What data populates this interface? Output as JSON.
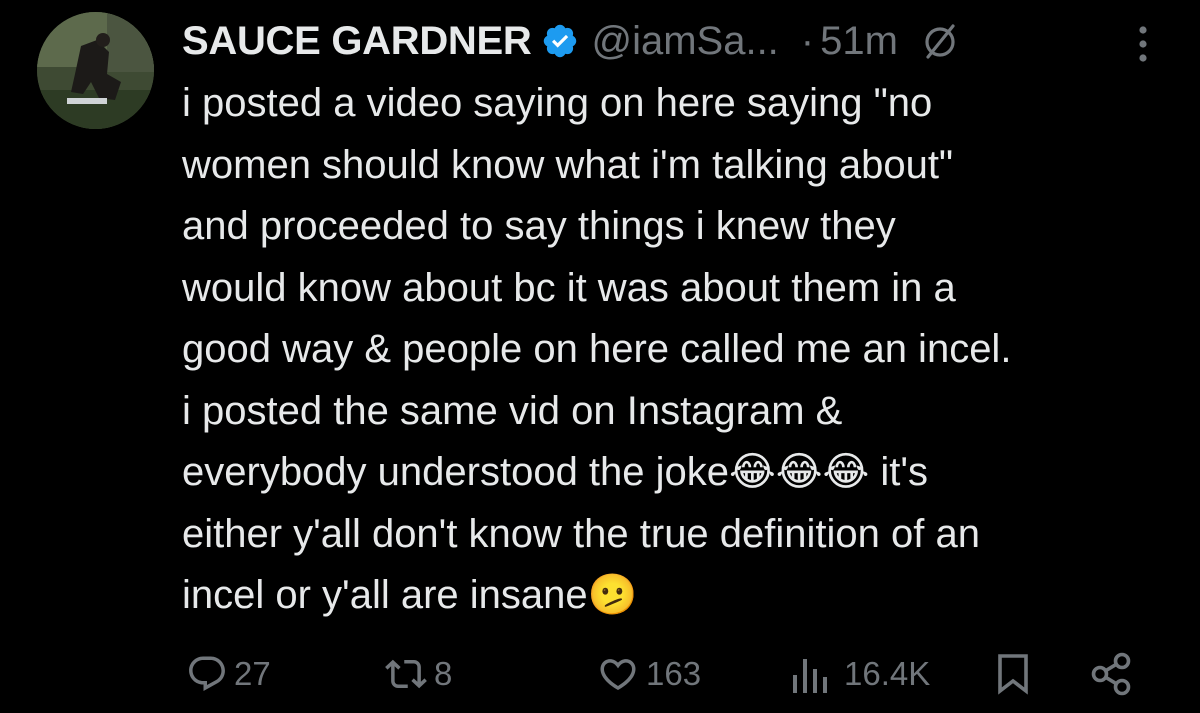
{
  "tweet": {
    "author_name": "SAUCE GARDNER",
    "handle": "@iamSa...",
    "separator": "·",
    "time": "51m",
    "text": "i posted a video saying on here saying \"no\nwomen should know what i'm talking about\"\nand proceeded to say things i knew they\nwould know about bc it was about them in a\ngood way & people on here called me an incel.\ni posted the same vid on Instagram &\neverybody understood the joke😂😂😂 it's\neither y'all don't know the true definition of an\nincel or y'all are insane🫤",
    "colors": {
      "background": "#000000",
      "text": "#e7e9ea",
      "secondary": "#71767b",
      "verified": "#1d9bf0"
    }
  },
  "actions": {
    "replies": "27",
    "reposts": "8",
    "likes": "163",
    "views": "16.4K",
    "icons": [
      "reply-icon",
      "repost-icon",
      "like-icon",
      "views-icon",
      "bookmark-icon",
      "share-icon"
    ]
  }
}
